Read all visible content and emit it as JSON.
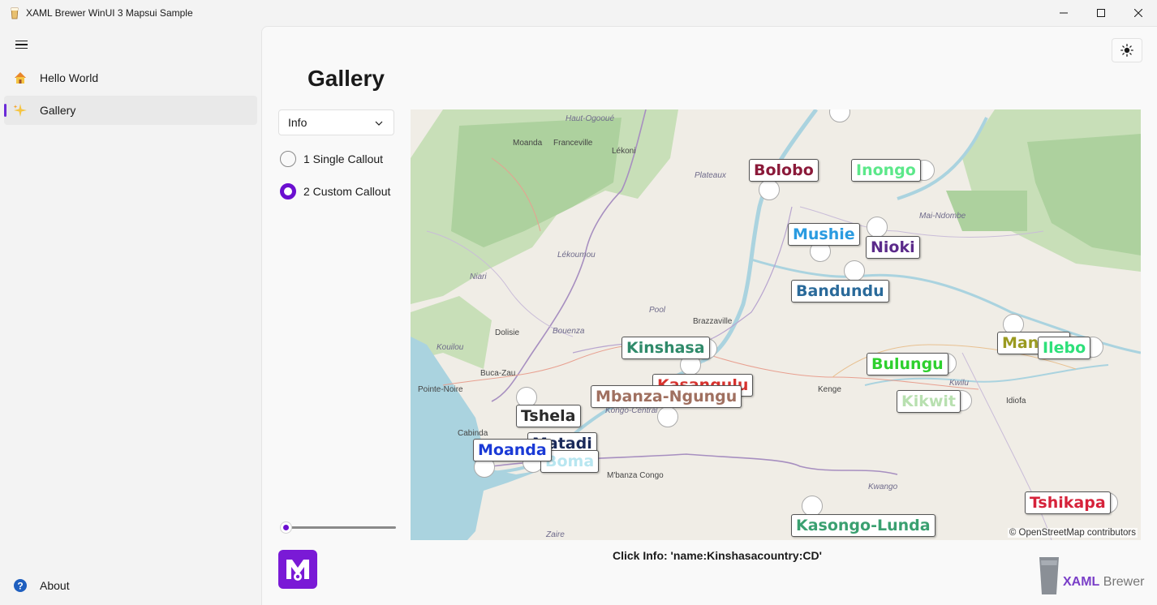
{
  "window": {
    "title": "XAML Brewer WinUI 3 Mapsui Sample"
  },
  "nav": {
    "items": [
      {
        "label": "Hello World",
        "icon": "house-icon"
      },
      {
        "label": "Gallery",
        "icon": "sparkle-icon",
        "selected": true
      }
    ],
    "footer": {
      "label": "About",
      "icon": "help-icon"
    }
  },
  "page": {
    "title": "Gallery",
    "combo": {
      "value": "Info"
    },
    "radios": [
      {
        "label": "1 Single Callout",
        "checked": false
      },
      {
        "label": "2 Custom Callout",
        "checked": true
      }
    ],
    "slider": {
      "value": 0
    },
    "click_info": "Click Info: 'name:Kinshasacountry:CD'"
  },
  "map": {
    "attribution": "© OpenStreetMap contributors",
    "places": [
      "Haut-Ogooué",
      "Moanda",
      "Franceville",
      "Lékoni",
      "Plateaux",
      "Lékoumou",
      "Niari",
      "Pool",
      "Brazzaville",
      "Dolisie",
      "Bouenza",
      "Kouilou",
      "Buca-Zau",
      "Pointe-Noire",
      "Cabinda",
      "Kongo-Central",
      "M'banza Congo",
      "Zaire",
      "Mai-Ndombe",
      "Kenge",
      "Kwilu",
      "Idiofa",
      "Kwango"
    ],
    "callouts": [
      {
        "name": "Bolobo",
        "color": "#8b1a3a"
      },
      {
        "name": "Inongo",
        "color": "#5ce88a"
      },
      {
        "name": "Mushie",
        "color": "#2a9be0"
      },
      {
        "name": "Nioki",
        "color": "#5b2a8a"
      },
      {
        "name": "Bandundu",
        "color": "#2a6a9a"
      },
      {
        "name": "Kinshasa",
        "color": "#2f8a6a"
      },
      {
        "name": "Kasangulu",
        "color": "#d6322e"
      },
      {
        "name": "Mbanza-Ngungu",
        "color": "#a07060"
      },
      {
        "name": "Tshela",
        "color": "#2a2a2a"
      },
      {
        "name": "Matadi",
        "color": "#1a2a5a"
      },
      {
        "name": "Moanda",
        "color": "#1a3ad6"
      },
      {
        "name": "Boma",
        "color": "#b8e6f0"
      },
      {
        "name": "Bulungu",
        "color": "#2ed02e"
      },
      {
        "name": "Kikwit",
        "color": "#b8e0b0"
      },
      {
        "name": "Mangai",
        "color": "#9a9a20"
      },
      {
        "name": "Ilebo",
        "color": "#2ee07a"
      },
      {
        "name": "Tshikapa",
        "color": "#d6223a"
      },
      {
        "name": "Kasongo-Lunda",
        "color": "#3aa070"
      }
    ]
  },
  "branding": {
    "brand_a": "XAML",
    "brand_b": " Brewer"
  },
  "colors": {
    "accent": "#6b0fd0",
    "water": "#aad3df",
    "forest": "#add19e"
  }
}
